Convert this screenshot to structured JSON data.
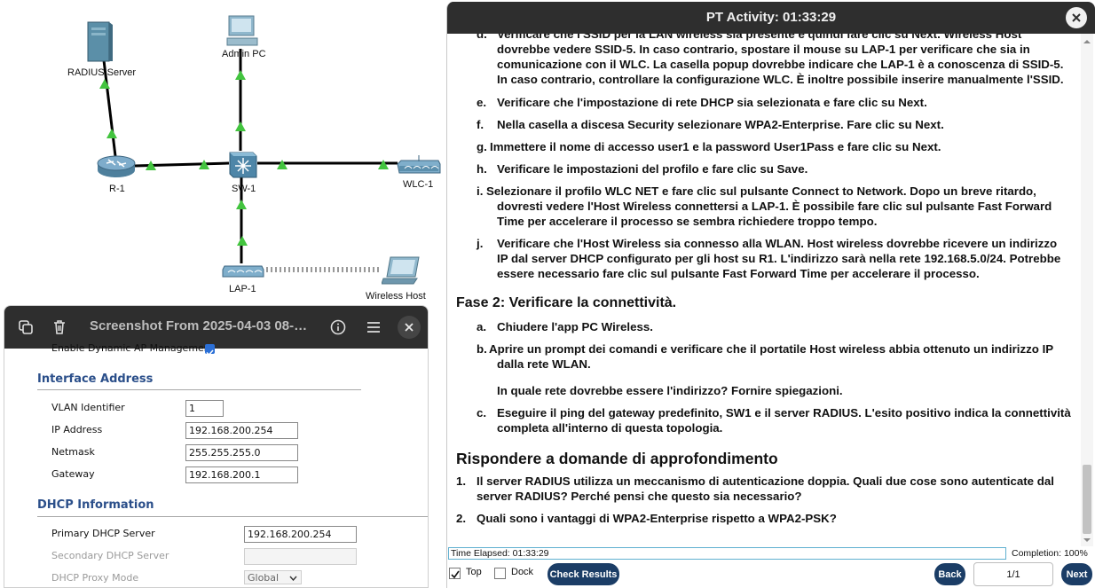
{
  "topology": {
    "devices": {
      "radius": "RADIUS Server",
      "admin": "Admin PC",
      "router": "R-1",
      "switch": "SW-1",
      "wlc": "WLC-1",
      "lap": "LAP-1",
      "host": "Wireless Host"
    },
    "link_color": "#000000",
    "indicator_color": "#43c43f"
  },
  "viewer": {
    "title": "Screenshot From 2025-04-03 08-…",
    "partial_line": "Enable Dynamic AP Management",
    "interface_section": "Interface Address",
    "vlan_label": "VLAN Identifier",
    "vlan_value": "1",
    "ip_label": "IP Address",
    "ip_value": "192.168.200.254",
    "netmask_label": "Netmask",
    "netmask_value": "255.255.255.0",
    "gateway_label": "Gateway",
    "gateway_value": "192.168.200.1",
    "dhcp_section": "DHCP Information",
    "primary_dhcp_label": "Primary DHCP Server",
    "primary_dhcp_value": "192.168.200.254",
    "secondary_dhcp_label": "Secondary DHCP Server",
    "secondary_dhcp_value": "",
    "proxy_label": "DHCP Proxy Mode",
    "proxy_value": "Global",
    "section_color": "#2b4f8a"
  },
  "activity": {
    "title": "PT Activity: 01:33:29",
    "step_d_marker": "d.",
    "step_d_lines": [
      "Verificare che l'SSID per la LAN wireless sia presente e quindi fare clic su Next. Wireless Host",
      "dovrebbe vedere SSID-5. In caso contrario, spostare il mouse su LAP-1 per verificare che sia in",
      "comunicazione con il WLC. La casella popup dovrebbe indicare che LAP-1 è a conoscenza di SSID-5.",
      "In caso contrario, controllare la configurazione WLC. È inoltre possibile inserire manualmente l'SSID."
    ],
    "step_e_marker": "e.",
    "step_e": "Verificare che l'impostazione di rete DHCP sia selezionata e fare clic su Next.",
    "step_f_marker": "f.",
    "step_f": "Nella casella a discesa Security selezionare WPA2-Enterprise. Fare clic su Next.",
    "step_g_marker": "g.",
    "step_g": "Immettere il nome di accesso user1 e la password User1Pass e fare clic su Next.",
    "step_h_marker": "h.",
    "step_h": "Verificare le impostazioni del profilo e fare clic su Save.",
    "step_i_marker": "i.",
    "step_i_lines": [
      "Selezionare il profilo WLC NET e fare clic sul pulsante Connect to Network. Dopo un breve ritardo,",
      "dovresti vedere l'Host Wireless connettersi a LAP-1. È possibile fare clic sul pulsante Fast Forward",
      "Time per accelerare il processo se sembra richiedere troppo tempo."
    ],
    "step_j_marker": "j.",
    "step_j_lines": [
      "Verificare che l'Host Wireless sia connesso alla WLAN. Host wireless dovrebbe ricevere un indirizzo",
      "IP dal server DHCP configurato per gli host su R1. L'indirizzo sarà nella rete 192.168.5.0/24. Potrebbe",
      "essere necessario fare clic sul pulsante Fast Forward Time per accelerare il processo."
    ],
    "fase2_title": "Fase 2: Verificare la connettività.",
    "fase2_a_marker": "a.",
    "fase2_a": "Chiudere l'app PC Wireless.",
    "fase2_b_marker": "b.",
    "fase2_b_lines": [
      "Aprire un prompt dei comandi e verificare che il portatile Host wireless abbia ottenuto un indirizzo IP",
      "dalla rete WLAN."
    ],
    "fase2_b_question": "In quale rete dovrebbe essere l'indirizzo? Fornire spiegazioni.",
    "fase2_c_marker": "c.",
    "fase2_c_lines": [
      "Eseguire il ping del gateway predefinito, SW1 e il server RADIUS. L'esito positivo indica la connettività",
      "completa all'interno di questa topologia."
    ],
    "rispondere_title": "Rispondere a domande di approfondimento",
    "q1_marker": "1.",
    "q1_lines": [
      "Il server RADIUS utilizza un meccanismo di autenticazione doppia. Quali due cose sono autenticate dal",
      "server RADIUS? Perché pensi che questo sia necessario?"
    ],
    "q2_marker": "2.",
    "q2": "Quali sono i vantaggi di WPA2-Enterprise rispetto a WPA2-PSK?",
    "time_elapsed": "Time Elapsed: 01:33:29",
    "completion": "Completion: 100%",
    "top_label": "Top",
    "top_checked": true,
    "dock_label": "Dock",
    "dock_checked": false,
    "check_results": "Check Results",
    "back": "Back",
    "page": "1/1",
    "next": "Next",
    "button_color": "#1b3d66"
  }
}
